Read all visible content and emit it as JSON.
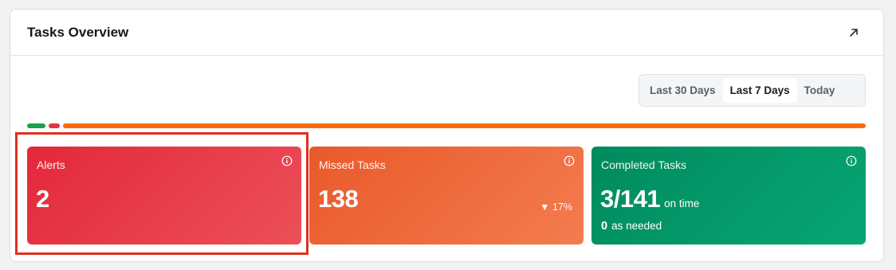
{
  "header": {
    "title": "Tasks Overview",
    "expand_icon": "arrow-up-right-icon"
  },
  "range": {
    "options": [
      "Last 30 Days",
      "Last 7 Days",
      "Today"
    ],
    "selected": "Last 7 Days"
  },
  "status_bar": {
    "segments": [
      {
        "name": "completed",
        "color": "#16a34a"
      },
      {
        "name": "alerts",
        "color": "#e5323f"
      },
      {
        "name": "missed",
        "color": "#fb6a0a"
      }
    ]
  },
  "tiles": {
    "alerts": {
      "label": "Alerts",
      "value": "2",
      "color": "#e3283a",
      "info_icon": "info-icon"
    },
    "missed": {
      "label": "Missed Tasks",
      "value": "138",
      "change": "▼ 17%",
      "color": "#e9592a",
      "info_icon": "info-icon"
    },
    "completed": {
      "label": "Completed Tasks",
      "value": "3/141",
      "value_suffix": "on time",
      "secondary_value": "0",
      "secondary_suffix": "as needed",
      "color": "#008a5e",
      "info_icon": "info-icon"
    }
  },
  "highlight_color": "#e0301e"
}
